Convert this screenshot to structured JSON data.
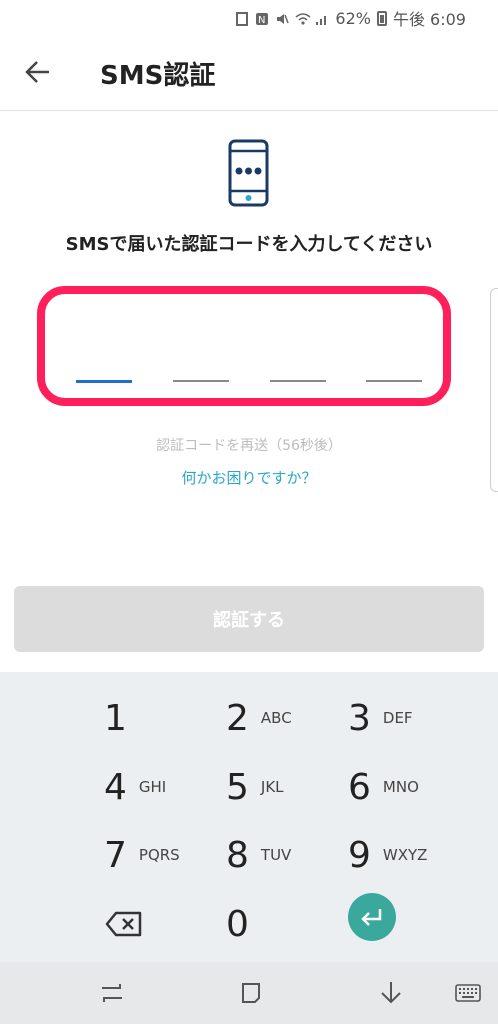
{
  "status": {
    "battery_percent": "62%",
    "time": "午後 6:09"
  },
  "header": {
    "title": "SMS認証"
  },
  "main": {
    "instruction": "SMSで届いた認証コードを入力してください",
    "resend": "認証コードを再送（56秒後）",
    "help": "何かお困りですか？",
    "verify_label": "認証する"
  },
  "keypad": {
    "rows": [
      [
        {
          "num": "1",
          "letters": ""
        },
        {
          "num": "2",
          "letters": "ABC"
        },
        {
          "num": "3",
          "letters": "DEF"
        }
      ],
      [
        {
          "num": "4",
          "letters": "GHI"
        },
        {
          "num": "5",
          "letters": "JKL"
        },
        {
          "num": "6",
          "letters": "MNO"
        }
      ],
      [
        {
          "num": "7",
          "letters": "PQRS"
        },
        {
          "num": "8",
          "letters": "TUV"
        },
        {
          "num": "9",
          "letters": "WXYZ"
        }
      ]
    ],
    "zero": "0"
  },
  "colors": {
    "highlight": "#ff1f5a",
    "accent": "#2aa8c9",
    "enter": "#3aa89c",
    "active_digit": "#1e6fc8"
  }
}
